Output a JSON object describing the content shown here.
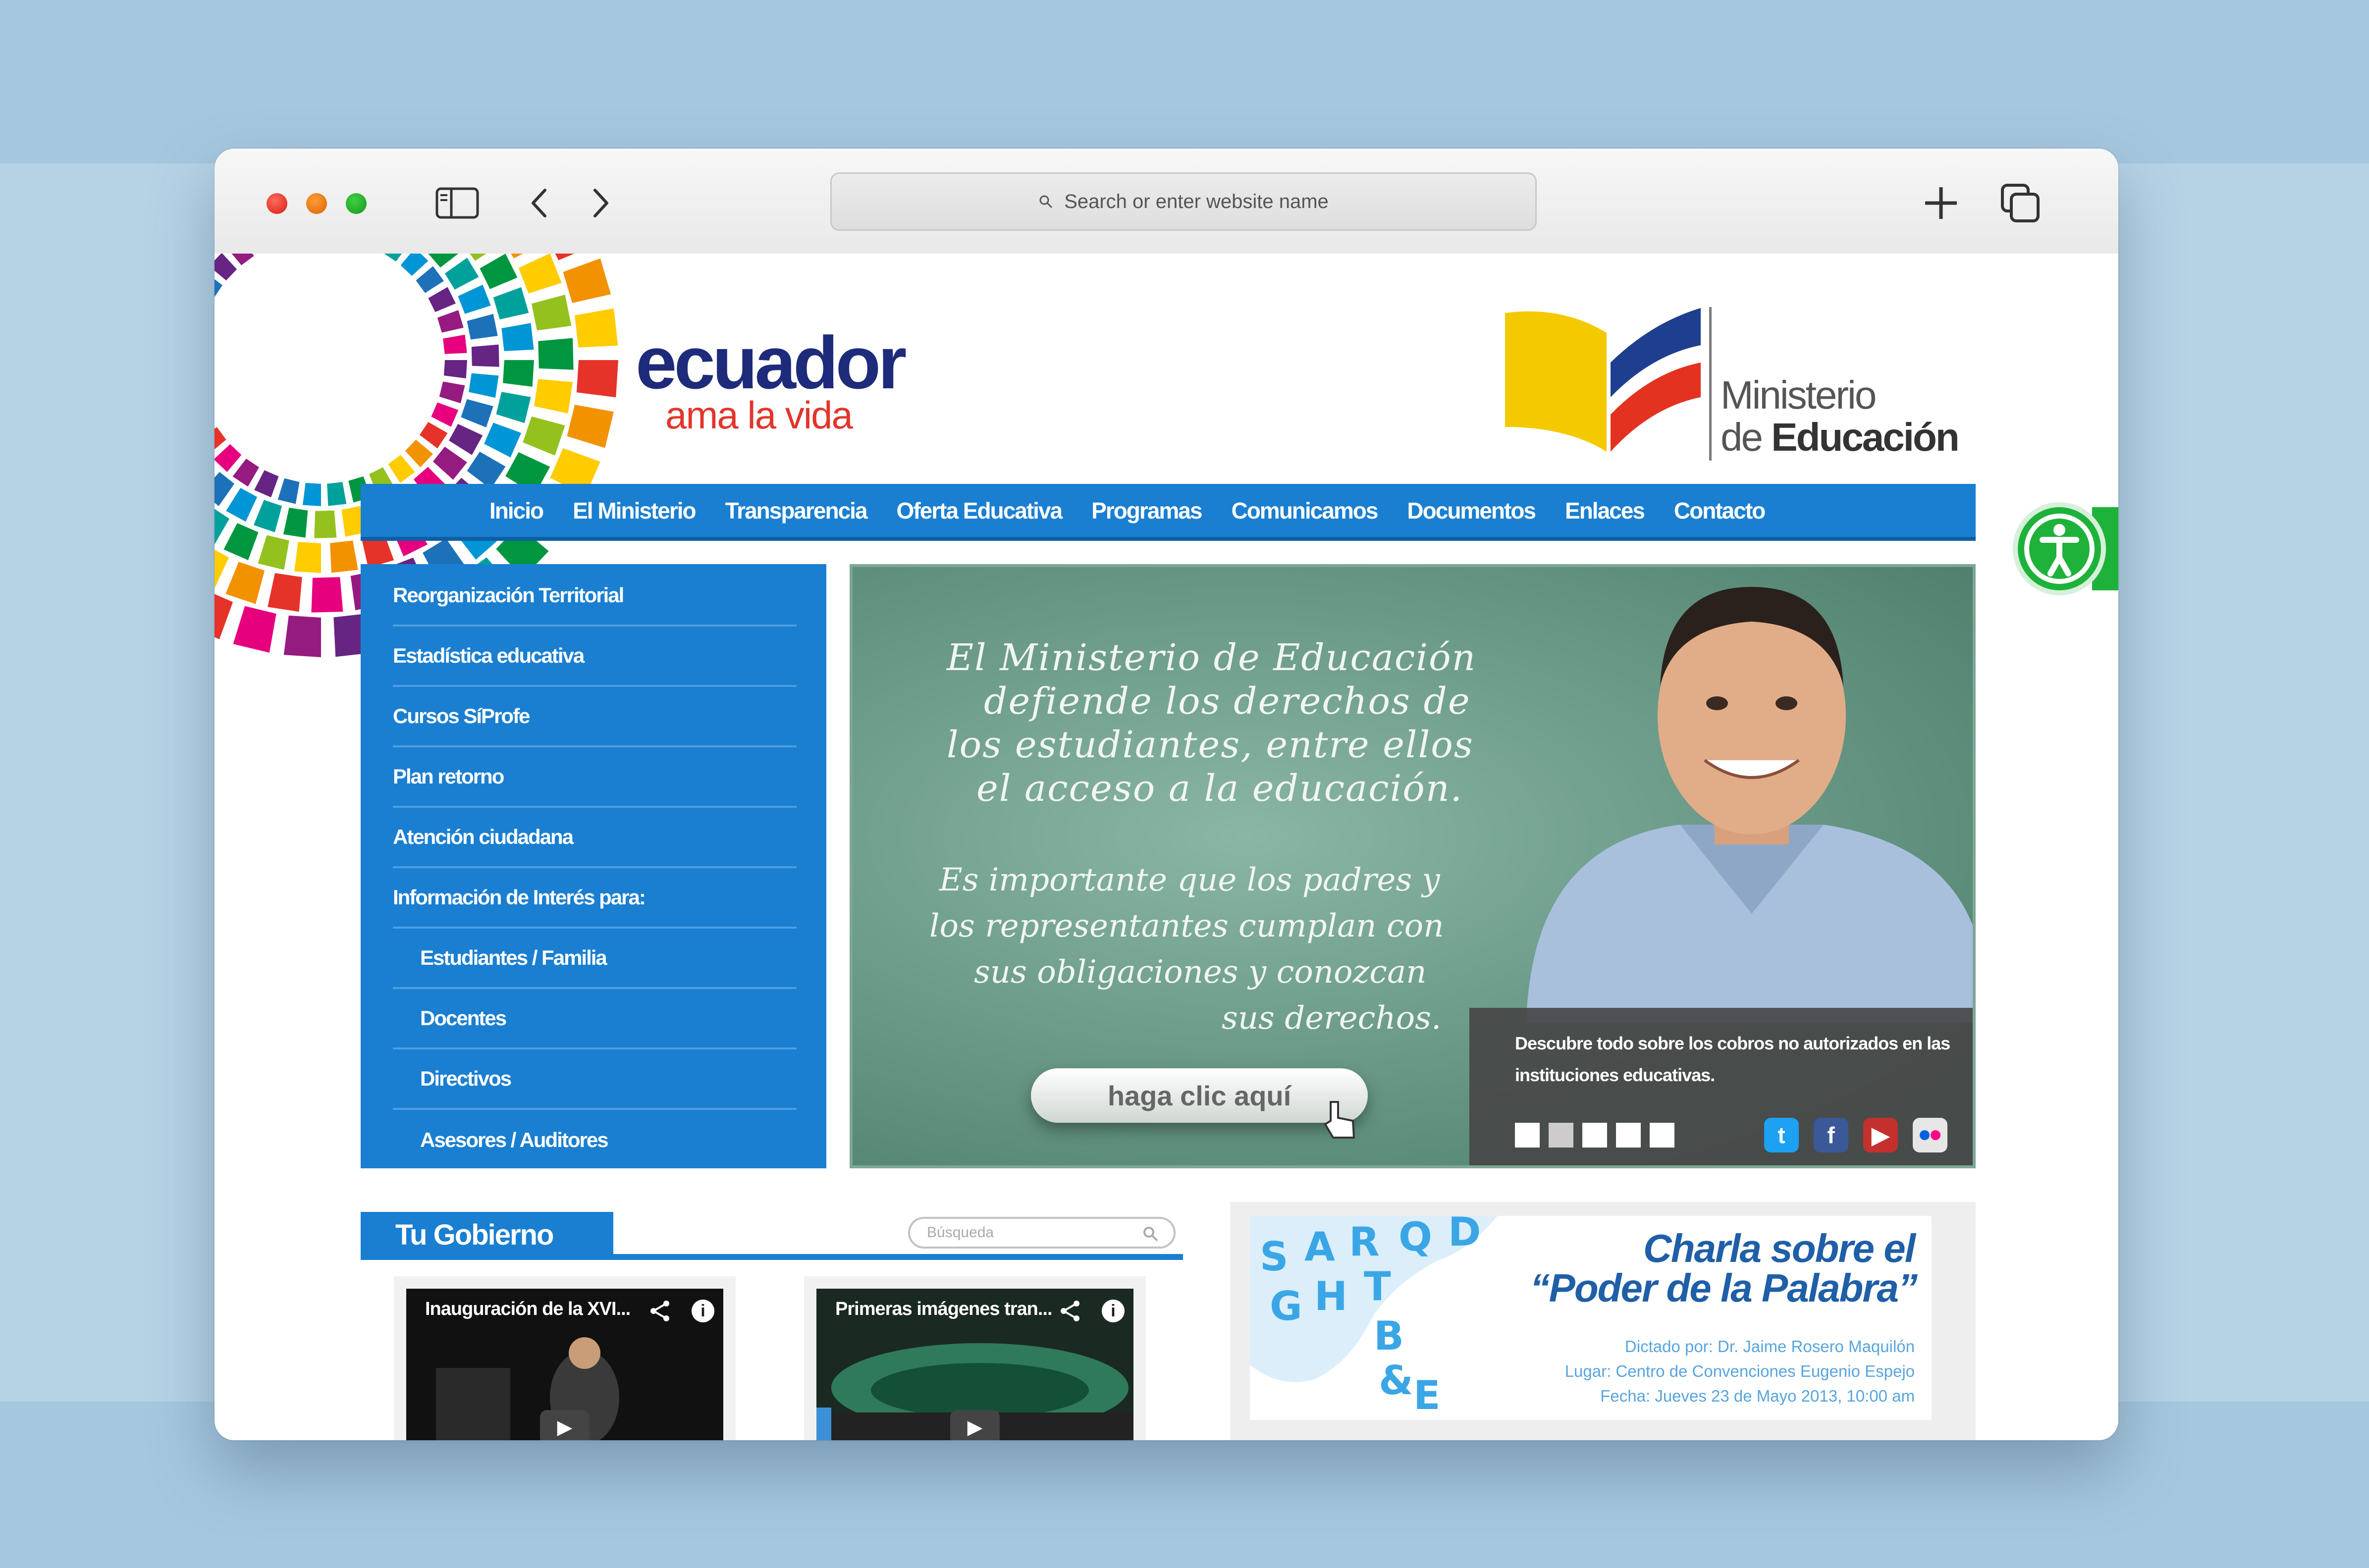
{
  "browser": {
    "address_placeholder": "Search or enter website name"
  },
  "site": {
    "brand_main": "ecuador",
    "brand_sub": "ama la vida",
    "ministry_line1": "Ministerio",
    "ministry_line2_prefix": "de ",
    "ministry_line2_bold": "Educación"
  },
  "nav": {
    "items": [
      "Inicio",
      "El Ministerio",
      "Transparencia",
      "Oferta Educativa",
      "Programas",
      "Comunicamos",
      "Documentos",
      "Enlaces",
      "Contacto"
    ]
  },
  "sidebar": {
    "items": [
      "Reorganización Territorial",
      "Estadística educativa",
      "Cursos SíProfe",
      "Plan retorno",
      "Atención ciudadana",
      "Información de Interés para:",
      "Estudiantes / Familia",
      "Docentes",
      "Directivos",
      "Asesores / Auditores"
    ]
  },
  "hero": {
    "headline": [
      "El Ministerio de Educación",
      "defiende los derechos de",
      "los estudiantes, entre ellos",
      "el acceso a la educación."
    ],
    "body": [
      "Es importante que los padres y",
      "los representantes cumplan con",
      "sus obligaciones y conozcan",
      "sus derechos."
    ],
    "cta": "haga clic aquí",
    "caption": "Descubre todo sobre los cobros no autorizados en las instituciones educativas.",
    "social": [
      "twitter-icon",
      "facebook-icon",
      "youtube-icon",
      "flickr-icon"
    ]
  },
  "tu_gobierno": {
    "title": "Tu Gobierno",
    "search_placeholder": "Búsqueda",
    "videos": [
      {
        "title": "Inauguración de la XVI..."
      },
      {
        "title": "Primeras imágenes tran..."
      }
    ]
  },
  "event": {
    "title_line1": "Charla sobre el",
    "title_line2": "“Poder de la Palabra”",
    "line1": "Dictado por: Dr. Jaime Rosero Maquilón",
    "line2": "Lugar: Centro de Convenciones Eugenio Espejo",
    "line3": "Fecha: Jueves 23 de Mayo 2013, 10:00 am"
  },
  "colors": {
    "nav_blue": "#1a7fd0",
    "brand_navy": "#1e2a7a",
    "brand_red": "#e2352b",
    "accessibility_green": "#1fb23a"
  }
}
